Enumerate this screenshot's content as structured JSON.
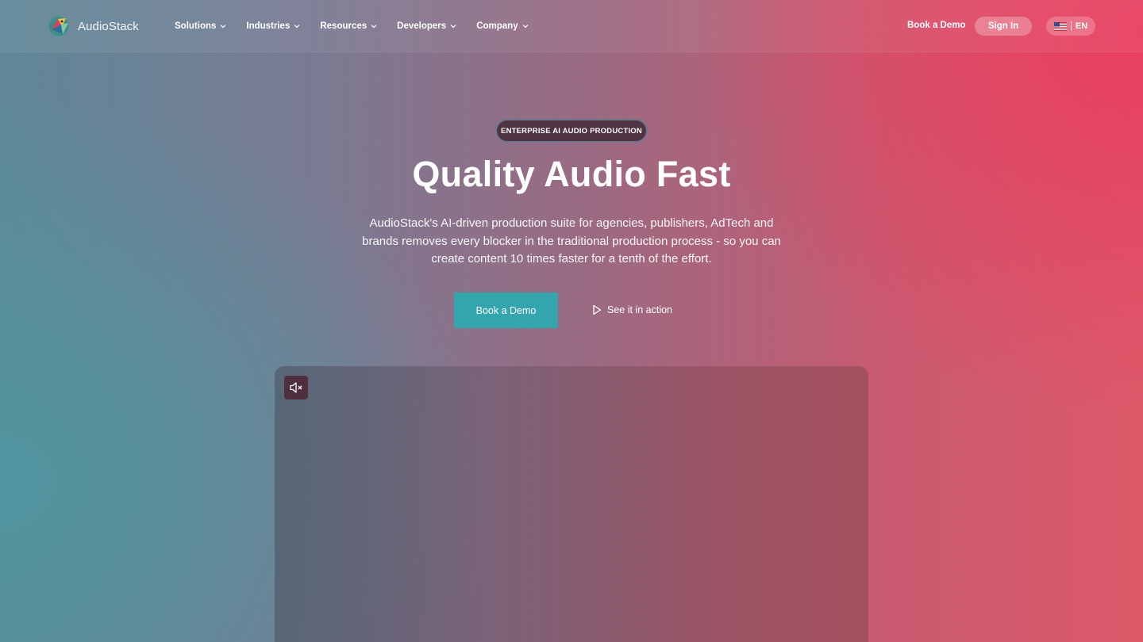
{
  "nav": {
    "logo_text": "AudioStack",
    "menu": [
      {
        "label": "Solutions"
      },
      {
        "label": "Industries"
      },
      {
        "label": "Resources"
      },
      {
        "label": "Developers"
      },
      {
        "label": "Company"
      }
    ],
    "book_demo": "Book a Demo",
    "sign_in": "Sign In",
    "language": "EN"
  },
  "hero": {
    "badge": "ENTERPRISE AI AUDIO PRODUCTION",
    "headline": "Quality Audio Fast",
    "subtext": "AudioStack's AI-driven production suite for agencies, publishers, AdTech and brands removes every blocker in the traditional production process - so you can create content 10 times faster for a tenth of the effort.",
    "cta_primary": "Book a Demo",
    "cta_secondary": "See it in action"
  },
  "video": {
    "mute_icon": "speaker-muted-icon"
  },
  "colors": {
    "accent_teal": "#33a6ad",
    "badge_bg": "#4f3341",
    "gradient_left": "#5f8797",
    "gradient_right": "#e83e5f"
  }
}
